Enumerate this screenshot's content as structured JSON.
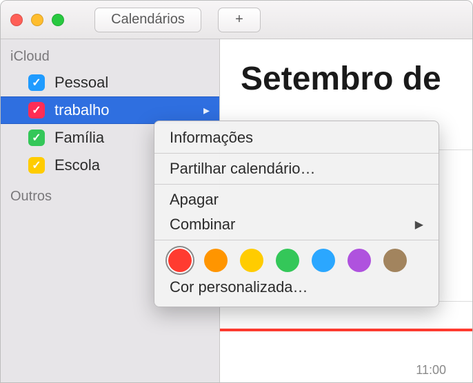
{
  "toolbar": {
    "calendars_label": "Calendários",
    "add_glyph": "+"
  },
  "sidebar": {
    "groups": [
      {
        "label": "iCloud",
        "items": [
          {
            "label": "Pessoal",
            "color": "#1f9bff",
            "selected": false
          },
          {
            "label": "trabalho",
            "color": "#ff2d55",
            "selected": true
          },
          {
            "label": "Família",
            "color": "#34c759",
            "selected": false
          },
          {
            "label": "Escola",
            "color": "#ffcc00",
            "selected": false
          }
        ]
      },
      {
        "label": "Outros",
        "items": []
      }
    ]
  },
  "main": {
    "title": "Setembro de",
    "time_label": "11:00"
  },
  "menu": {
    "info": "Informações",
    "share": "Partilhar calendário…",
    "delete": "Apagar",
    "merge": "Combinar",
    "custom_color": "Cor personalizada…",
    "colors": [
      {
        "hex": "#ff3b30",
        "selected": true
      },
      {
        "hex": "#ff9500",
        "selected": false
      },
      {
        "hex": "#ffcc00",
        "selected": false
      },
      {
        "hex": "#34c759",
        "selected": false
      },
      {
        "hex": "#2ba7ff",
        "selected": false
      },
      {
        "hex": "#af52de",
        "selected": false
      },
      {
        "hex": "#a2845e",
        "selected": false
      }
    ]
  }
}
